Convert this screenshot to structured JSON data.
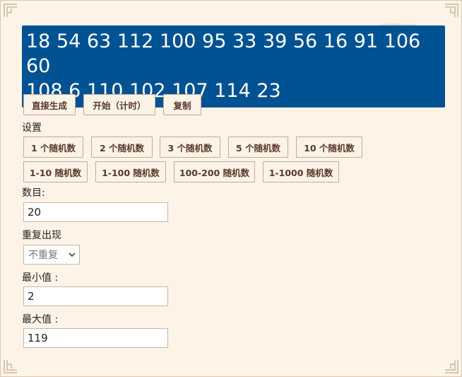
{
  "result": {
    "line1": "18 54 63 112 100 95 33 39 56 16 91 106 60",
    "line2": "108 6 110 102 107 114 23"
  },
  "actions": {
    "generate": "直接生成",
    "start_timed": "开始（计时）",
    "copy": "复制"
  },
  "settings_label": "设置",
  "presets_count": [
    "1 个随机数",
    "2 个随机数",
    "3 个随机数",
    "5 个随机数",
    "10 个随机数"
  ],
  "presets_range": [
    "1-10 随机数",
    "1-100 随机数",
    "100-200 随机数",
    "1-1000 随机数"
  ],
  "form": {
    "count_label": "数目:",
    "count_value": "20",
    "repeat_label": "重复出现",
    "repeat_value": "不重复",
    "min_label": "最小值  :",
    "min_value": "2",
    "max_label": "最大值  :",
    "max_value": "119"
  },
  "colors": {
    "result_bg": "#005293",
    "page_bg": "#fdf4e7",
    "button_border": "#c8a89a"
  }
}
